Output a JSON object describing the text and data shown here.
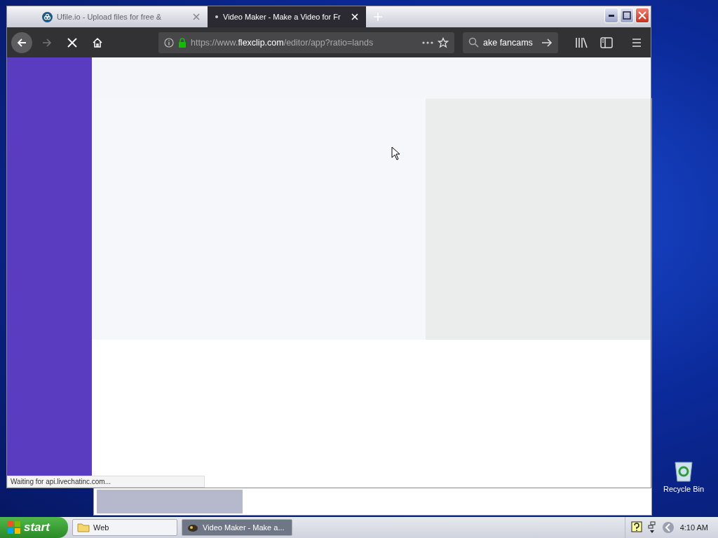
{
  "browser": {
    "tabs": [
      {
        "title": "Ufile.io - Upload files for free &",
        "selected": false
      },
      {
        "title": "Video Maker - Make a Video for Fr",
        "selected": true
      }
    ],
    "loading": true,
    "url": "https://www.**flexclip.com**/editor/app?ratio=lands",
    "search": {
      "value": "ake fancams"
    },
    "status": "Waiting for api.livechatinc.com..."
  },
  "desktop_icons": [
    {
      "label": "Recycle Bin"
    }
  ],
  "taskbar": {
    "start": "start",
    "tasks": [
      {
        "label": "Web",
        "selected": false
      },
      {
        "label": "Video Maker - Make a...",
        "selected": true
      }
    ],
    "clock": "4:10 AM"
  }
}
